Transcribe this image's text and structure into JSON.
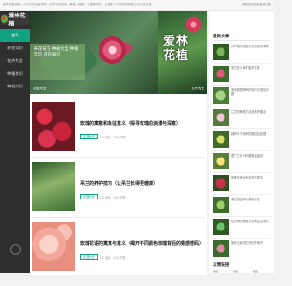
{
  "topbar": {
    "left_text": "爱林花植网是一个中文花卉资讯网，分享花卉知识、养殖、种植、花语等内容，让更多人了解花卉的魅力与生活之美。",
    "right_text": "养花知识就在爱林花植"
  },
  "sidebar": {
    "logo_text": "爱林花植",
    "items": [
      {
        "label": "首页"
      },
      {
        "label": "养花知识"
      },
      {
        "label": "花卉大全"
      },
      {
        "label": "种植常识"
      },
      {
        "label": "种花知识"
      }
    ]
  },
  "hero": {
    "overlay_text": "养花技巧 种植大全 种植常识 花卉知识",
    "caption": "花语大全"
  },
  "promo": {
    "text_line1": "爱林",
    "text_line2": "花植",
    "caption": "花卉大全"
  },
  "right": {
    "latest_title": "最新文章",
    "latest_items": [
      {
        "text": "月季花的养殖方法和注意事项"
      },
      {
        "text": "茶花怎么养才能开花多"
      },
      {
        "text": "多肉植物的养护技巧与常见问题"
      },
      {
        "text": "兰花的种植方法及养护要点"
      },
      {
        "text": "绿萝叶子发黄的原因及处理"
      },
      {
        "text": "君子兰什么时候换盆最好"
      },
      {
        "text": "玫瑰花语大全及送花寓意"
      },
      {
        "text": "菊花的品种与栽培方法"
      },
      {
        "text": "桂花树的养殖方法和注意事项"
      },
      {
        "text": "如何让家中花卉四季常开"
      }
    ],
    "friends_title": "友情链接",
    "friends": [
      {
        "label": "链接"
      },
      {
        "label": "链接"
      },
      {
        "label": "链接"
      }
    ]
  },
  "articles": [
    {
      "title": "玫瑰的寓意和象征意义（探寻玫瑰的浪漫与深意）",
      "tag": "花语大全",
      "views": "12 阅读",
      "time": "12小时前"
    },
    {
      "title": "吊兰的养护技巧（让吊兰长得更健康）",
      "tag": "花语大全",
      "views": "12 阅读",
      "time": "12小时前"
    },
    {
      "title": "玫瑰花语的寓意与意义（揭开不同颜色玫瑰背后的情感密码）",
      "tag": "花语大全",
      "views": "12 阅读",
      "time": "12小时前"
    }
  ],
  "colors": {
    "accent": "#11a37f",
    "sidebar_bg": "#2f2f2f"
  }
}
